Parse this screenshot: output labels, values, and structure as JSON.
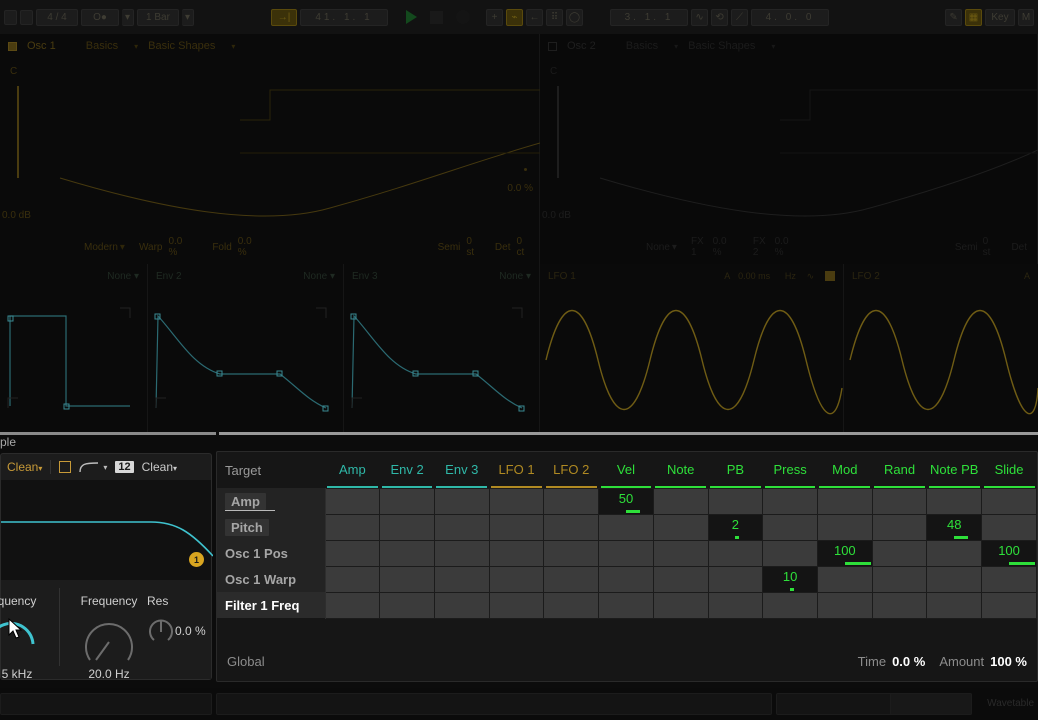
{
  "transport": {
    "metronome_icon": "metronome-icon",
    "groove_icon": "groove-pool-icon",
    "time_signature": "4 / 4",
    "quantization": "O●",
    "launch_quantization": "1 Bar",
    "follow_icon": "follow-icon",
    "position": "41. 1. 1",
    "play_icon": "play-icon",
    "stop_icon": "stop-icon",
    "record_icon": "record-icon",
    "draw_add_icon": "plus-icon",
    "automation_icon": "automation-mode-icon",
    "back_icon": "back-to-arrangement-icon",
    "grid_icon": "grid-icon",
    "loop_circle_icon": "loop-icon",
    "loop_start": "3. 1. 1",
    "fade_icon": "fade-icon",
    "loop_toggle_icon": "loop-toggle-icon",
    "punch_icon": "punch-icon",
    "loop_length": "4. 0. 0",
    "pencil_icon": "draw-mode-icon",
    "keyboard_icon": "midi-keyboard-icon",
    "key_label": "Key",
    "midi_label": "M"
  },
  "osc1": {
    "enabled": true,
    "name": "Osc 1",
    "category": "Basics",
    "preset": "Basic Shapes",
    "note_label": "C",
    "gain": "0.0 dB",
    "effect_mode": "Modern",
    "warp_label": "Warp",
    "warp_value": "0.0 %",
    "fold_label": "Fold",
    "fold_value": "0.0 %",
    "semi_label": "Semi",
    "semi_value": "0 st",
    "detune_label": "Det",
    "detune_value": "0 ct",
    "pan_value": "0.0 %"
  },
  "osc2": {
    "enabled": false,
    "name": "Osc 2",
    "category": "Basics",
    "preset": "Basic Shapes",
    "note_label": "C",
    "gain": "0.0 dB",
    "effect_mode": "None",
    "fx1_label": "FX 1",
    "fx1_value": "0.0 %",
    "fx2_label": "FX 2",
    "fx2_value": "0.0 %",
    "semi_label": "Semi",
    "semi_value": "0 st",
    "detune_label": "Det"
  },
  "mod_sources": [
    {
      "name": "",
      "routing": "None",
      "type": "env"
    },
    {
      "name": "Env 2",
      "routing": "None",
      "type": "env"
    },
    {
      "name": "Env 3",
      "routing": "None",
      "type": "env"
    },
    {
      "name": "LFO 1",
      "attack_label": "A",
      "attack_value": "0.00 ms",
      "rate_unit": "Hz",
      "shape_icon": "lfo-shape-icon",
      "retrig_icon": "retrigger-icon",
      "type": "lfo"
    },
    {
      "name": "LFO 2",
      "attack_label": "A",
      "type": "lfo"
    }
  ],
  "browser": {
    "tail_label": "ple"
  },
  "filter_device": {
    "filter_type": "Clean",
    "circuit_icon": "filter-square-icon",
    "slope_icon": "filter-curve-icon",
    "slope_value": "12",
    "mode": "Clean",
    "marker_number": "1",
    "freq_knob_label": "quency",
    "freq_knob_value": "5 kHz",
    "freq2_label": "Frequency",
    "freq2_value": "20.0 Hz",
    "res_label": "Res",
    "res_value": "0.0 %",
    "cursor_icon": "mouse-cursor"
  },
  "matrix": {
    "corner_label": "Target",
    "columns": [
      {
        "label": "Amp",
        "color": "#2fb8a8"
      },
      {
        "label": "Env 2",
        "color": "#2fb8a8"
      },
      {
        "label": "Env 3",
        "color": "#2fb8a8"
      },
      {
        "label": "LFO 1",
        "color": "#b08a22"
      },
      {
        "label": "LFO 2",
        "color": "#b08a22"
      },
      {
        "label": "Vel",
        "color": "#2ee03a"
      },
      {
        "label": "Note",
        "color": "#2ee03a"
      },
      {
        "label": "PB",
        "color": "#2ee03a"
      },
      {
        "label": "Press",
        "color": "#2ee03a"
      },
      {
        "label": "Mod",
        "color": "#2ee03a"
      },
      {
        "label": "Rand",
        "color": "#2ee03a"
      },
      {
        "label": "Note PB",
        "color": "#2ee03a"
      },
      {
        "label": "Slide",
        "color": "#2ee03a"
      }
    ],
    "rows": [
      {
        "label": "Amp",
        "highlight": false,
        "underline": true,
        "chip": true,
        "values": [
          null,
          null,
          null,
          null,
          null,
          "50",
          null,
          null,
          null,
          null,
          null,
          null,
          null
        ]
      },
      {
        "label": "Pitch",
        "highlight": false,
        "underline": false,
        "chip": true,
        "values": [
          null,
          null,
          null,
          null,
          null,
          null,
          null,
          "2",
          null,
          null,
          null,
          "48",
          null
        ]
      },
      {
        "label": "Osc 1 Pos",
        "highlight": false,
        "underline": false,
        "chip": false,
        "values": [
          null,
          null,
          null,
          null,
          null,
          null,
          null,
          null,
          null,
          "100",
          null,
          null,
          "100"
        ]
      },
      {
        "label": "Osc 1 Warp",
        "highlight": false,
        "underline": false,
        "chip": false,
        "values": [
          null,
          null,
          null,
          null,
          null,
          null,
          null,
          null,
          "10",
          null,
          null,
          null,
          null
        ]
      },
      {
        "label": "Filter 1 Freq",
        "highlight": true,
        "underline": false,
        "chip": false,
        "values": [
          null,
          null,
          null,
          null,
          null,
          null,
          null,
          null,
          null,
          null,
          null,
          null,
          null
        ]
      }
    ],
    "global_label": "Global",
    "time_label": "Time",
    "time_value": "0.0 %",
    "amount_label": "Amount",
    "amount_value": "100 %"
  },
  "status": {
    "device_name": "Wavetable"
  }
}
